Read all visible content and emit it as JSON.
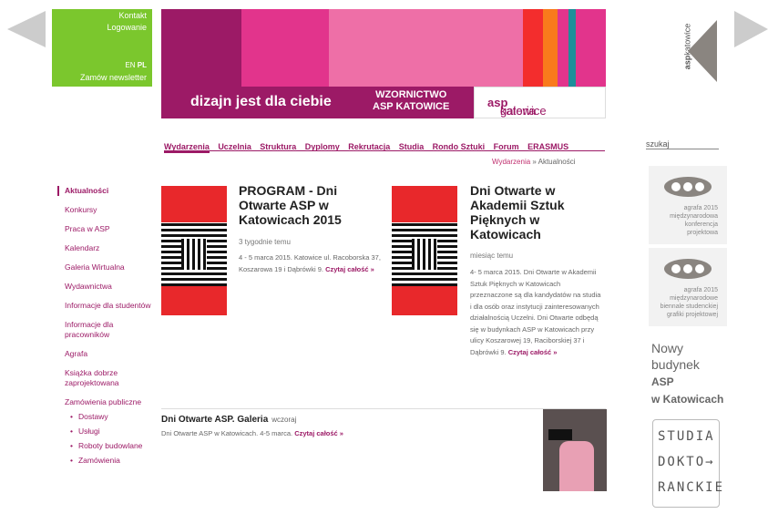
{
  "top_links": {
    "contact": "Kontakt",
    "login": "Logowanie",
    "lang_en": "EN",
    "lang_pl": "PL",
    "newsletter": "Zamów newsletter"
  },
  "banner": {
    "slogan": "dizajn jest dla ciebie",
    "wzornictwo_line1": "WZORNICTWO",
    "wzornictwo_line2": "ASP KATOWICE",
    "gallery_prefix": "galeria",
    "gallery_bold": "asp",
    "gallery_suffix": "katowice"
  },
  "logo": {
    "text_bold": "asp",
    "text": "katowice"
  },
  "nav": [
    {
      "label": "Wydarzenia"
    },
    {
      "label": "Uczelnia"
    },
    {
      "label": "Struktura"
    },
    {
      "label": "Dyplomy"
    },
    {
      "label": "Rekrutacja"
    },
    {
      "label": "Studia"
    },
    {
      "label": "Rondo Sztuki"
    },
    {
      "label": "Forum"
    },
    {
      "label": "ERASMUS"
    }
  ],
  "breadcrumb": {
    "item1": "Wydarzenia",
    "sep": " » ",
    "item2": "Aktualności"
  },
  "sidebar": {
    "items": [
      {
        "label": "Aktualności"
      },
      {
        "label": "Konkursy"
      },
      {
        "label": "Praca w ASP"
      },
      {
        "label": "Kalendarz"
      },
      {
        "label": "Galeria Wirtualna"
      },
      {
        "label": "Wydawnictwa"
      },
      {
        "label": "Informacje dla studentów"
      },
      {
        "label": "Informacje dla pracowników"
      },
      {
        "label": "Agrafa"
      },
      {
        "label": "Książka dobrze zaprojektowana"
      },
      {
        "label": "Zamówienia publiczne"
      }
    ],
    "subitems": [
      {
        "label": "Dostawy"
      },
      {
        "label": "Usługi"
      },
      {
        "label": "Roboty budowlane"
      },
      {
        "label": "Zamówienia"
      }
    ]
  },
  "articles": [
    {
      "title": "PROGRAM - Dni Otwarte ASP w Katowicach 2015",
      "date": "3 tygodnie temu",
      "body": "4 - 5 marca 2015. Katowice ul. Racoborska 37, Koszarowa 19 i Dąbrówki 9.",
      "more": "Czytaj całość »"
    },
    {
      "title": "Dni Otwarte w Akademii Sztuk Pięknych w Katowicach",
      "date": "miesiąc temu",
      "body": "4- 5 marca 2015. Dni Otwarte w Akademii Sztuk Pięknych w Katowicach przeznaczone są dla kandydatów na studia i dla osób oraz instytucji zainteresowanych działalnością Uczelni. Dni Otwarte odbędą się w budynkach ASP w Katowicach przy ulicy Koszarowej 19, Raciborskiej 37 i Dąbrówki 9.",
      "more": "Czytaj całość »"
    },
    {
      "title": "Dni Otwarte ASP. Galeria",
      "date": "wczoraj",
      "body": "Dni Otwarte ASP w Katowicach. 4-5 marca.",
      "more": "Czytaj całość »"
    }
  ],
  "right": {
    "search_label": "szukaj",
    "agrafa1": [
      "agrafa 2015",
      "międzynarodowa",
      "konferencja",
      "projektowa"
    ],
    "agrafa2": [
      "agrafa 2015",
      "międzynarodowe",
      "biennale studenckiej",
      "grafiki projektowej"
    ],
    "nowy": [
      "Nowy",
      "budynek",
      "ASP",
      "w Katowicach"
    ],
    "studia": [
      "STUDIA",
      "DOKTO→",
      "RANCKIE"
    ]
  },
  "colors": {
    "accent": "#9c1a66",
    "green": "#7bc72d",
    "red": "#e8282b"
  }
}
